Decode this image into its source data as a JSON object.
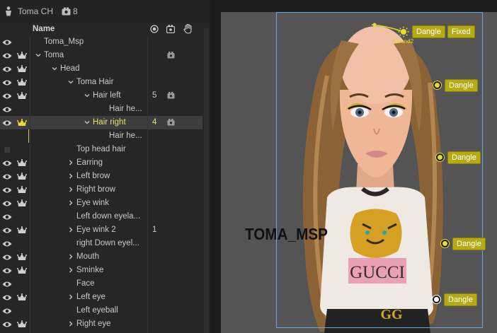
{
  "header": {
    "title": "Toma CH",
    "camera_count": "8"
  },
  "columns": {
    "name": "Name"
  },
  "layers": [
    {
      "name": "Toma_Msp",
      "indent": 0,
      "caret": "none",
      "eye": true,
      "crown": false,
      "num": "",
      "cam": false
    },
    {
      "name": "Toma",
      "indent": 0,
      "caret": "open",
      "eye": true,
      "crown": true,
      "num": "",
      "cam": true
    },
    {
      "name": "Head",
      "indent": 1,
      "caret": "open",
      "eye": true,
      "crown": true,
      "num": "",
      "cam": false
    },
    {
      "name": "Toma Hair",
      "indent": 2,
      "caret": "open",
      "eye": true,
      "crown": true,
      "num": "",
      "cam": false
    },
    {
      "name": "Hair left",
      "indent": 3,
      "caret": "open",
      "eye": true,
      "crown": true,
      "num": "5",
      "cam": true
    },
    {
      "name": "Hair he...",
      "indent": 4,
      "caret": "none",
      "eye": true,
      "crown": false,
      "num": "",
      "cam": false
    },
    {
      "name": "Hair right",
      "indent": 3,
      "caret": "open",
      "eye": true,
      "crown": true,
      "num": "4",
      "cam": true,
      "selected": true
    },
    {
      "name": "Hair he...",
      "indent": 4,
      "caret": "none",
      "eye": false,
      "crown": false,
      "num": "",
      "cam": false
    },
    {
      "name": "Top head hair",
      "indent": 2,
      "caret": "none",
      "eye": false,
      "square": true,
      "crown": false,
      "num": "",
      "cam": false
    },
    {
      "name": "Earring",
      "indent": 2,
      "caret": "closed",
      "eye": true,
      "crown": true,
      "num": "",
      "cam": false
    },
    {
      "name": "Left brow",
      "indent": 2,
      "caret": "closed",
      "eye": true,
      "crown": true,
      "num": "",
      "cam": false
    },
    {
      "name": "Right brow",
      "indent": 2,
      "caret": "closed",
      "eye": true,
      "crown": true,
      "num": "",
      "cam": false
    },
    {
      "name": "Eye wink",
      "indent": 2,
      "caret": "closed",
      "eye": true,
      "crown": true,
      "num": "",
      "cam": false
    },
    {
      "name": "Left down eyela...",
      "indent": 2,
      "caret": "none",
      "eye": true,
      "crown": false,
      "num": "",
      "cam": false
    },
    {
      "name": "Eye wink 2",
      "indent": 2,
      "caret": "closed",
      "eye": true,
      "crown": true,
      "num": "1",
      "cam": false
    },
    {
      "name": "right Down eyel...",
      "indent": 2,
      "caret": "none",
      "eye": true,
      "crown": false,
      "num": "",
      "cam": false
    },
    {
      "name": "Mouth",
      "indent": 2,
      "caret": "closed",
      "eye": true,
      "crown": true,
      "num": "",
      "cam": false
    },
    {
      "name": "Sminke",
      "indent": 2,
      "caret": "closed",
      "eye": true,
      "crown": true,
      "num": "",
      "cam": false
    },
    {
      "name": "Face",
      "indent": 2,
      "caret": "none",
      "eye": true,
      "crown": false,
      "num": "",
      "cam": false
    },
    {
      "name": "Left eye",
      "indent": 2,
      "caret": "closed",
      "eye": true,
      "crown": true,
      "num": "",
      "cam": false
    },
    {
      "name": "Left eyeball",
      "indent": 2,
      "caret": "none",
      "eye": true,
      "crown": false,
      "num": "",
      "cam": false
    },
    {
      "name": "Right eye",
      "indent": 2,
      "caret": "closed",
      "eye": true,
      "crown": true,
      "num": "",
      "cam": false
    }
  ],
  "canvas": {
    "overlay_text": "TOMA_MSP",
    "shirt_text": "GUCCI",
    "buckle_text": "GG",
    "strand_label": "Strand2",
    "handles": [
      {
        "tags": [
          "Dangle",
          "Fixed"
        ],
        "dot": "yellow"
      },
      {
        "tags": [
          "Dangle"
        ],
        "dot": "yellow"
      },
      {
        "tags": [
          "Dangle"
        ],
        "dot": "yellow"
      },
      {
        "tags": [
          "Dangle"
        ],
        "dot": "yellow"
      },
      {
        "tags": [
          "Dangle"
        ],
        "dot": "white"
      }
    ]
  },
  "colors": {
    "accent_yellow": "#e8dd2a",
    "selected_text": "#e5e078",
    "panel_bg": "#262626",
    "bbox_blue": "#6aa6e6"
  }
}
